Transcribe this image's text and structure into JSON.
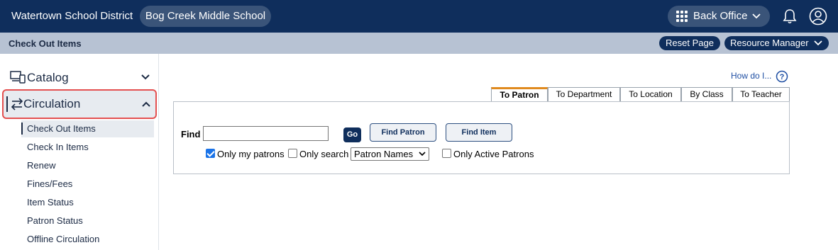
{
  "header": {
    "district": "Watertown School District",
    "school": "Bog Creek Middle School",
    "back_office_label": "Back Office"
  },
  "subheader": {
    "page_title": "Check Out Items",
    "reset_label": "Reset Page",
    "resource_manager_label": "Resource Manager"
  },
  "sidebar": {
    "catalog_label": "Catalog",
    "circulation_label": "Circulation",
    "items": [
      {
        "label": "Check Out Items"
      },
      {
        "label": "Check In Items"
      },
      {
        "label": "Renew"
      },
      {
        "label": "Fines/Fees"
      },
      {
        "label": "Item Status"
      },
      {
        "label": "Patron Status"
      },
      {
        "label": "Offline Circulation"
      }
    ]
  },
  "help": {
    "how_do_i": "How do I..."
  },
  "tabs": [
    {
      "label": "To Patron",
      "active": true
    },
    {
      "label": "To Department"
    },
    {
      "label": "To Location"
    },
    {
      "label": "By Class"
    },
    {
      "label": "To Teacher"
    }
  ],
  "search": {
    "find_label": "Find",
    "find_value": "",
    "go_label": "Go",
    "find_patron_label": "Find Patron",
    "find_item_label": "Find Item",
    "only_my_patrons_label": "Only my patrons",
    "only_my_patrons_checked": true,
    "only_search_label": "Only search",
    "only_search_checked": false,
    "search_scope_value": "Patron Names",
    "only_active_label": "Only Active Patrons",
    "only_active_checked": false
  },
  "colors": {
    "primary": "#0f2e5c",
    "subbar": "#b7c2d3",
    "tab_accent": "#e08a1e",
    "highlight_border": "#e45050"
  }
}
